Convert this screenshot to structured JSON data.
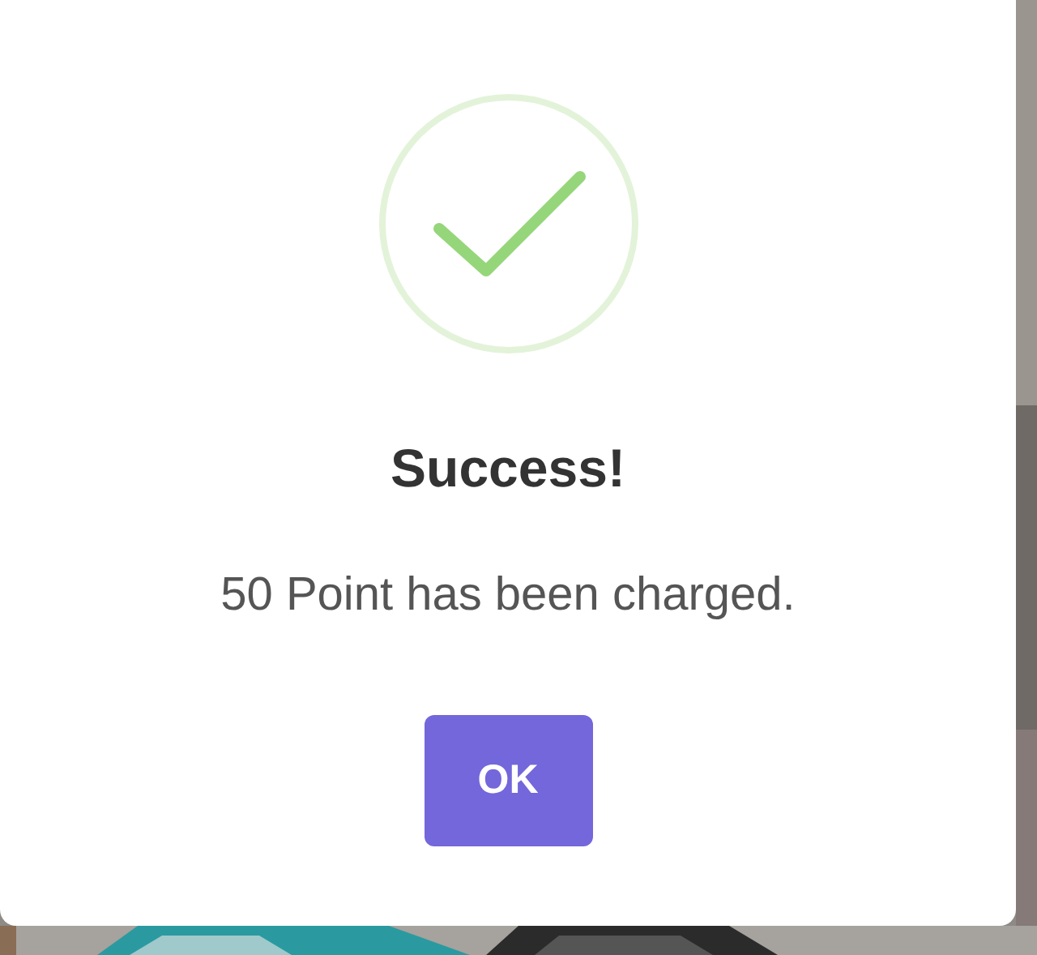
{
  "dialog": {
    "title": "Success!",
    "message": "50 Point has been charged.",
    "buttons": [
      {
        "label": "OK"
      }
    ]
  }
}
